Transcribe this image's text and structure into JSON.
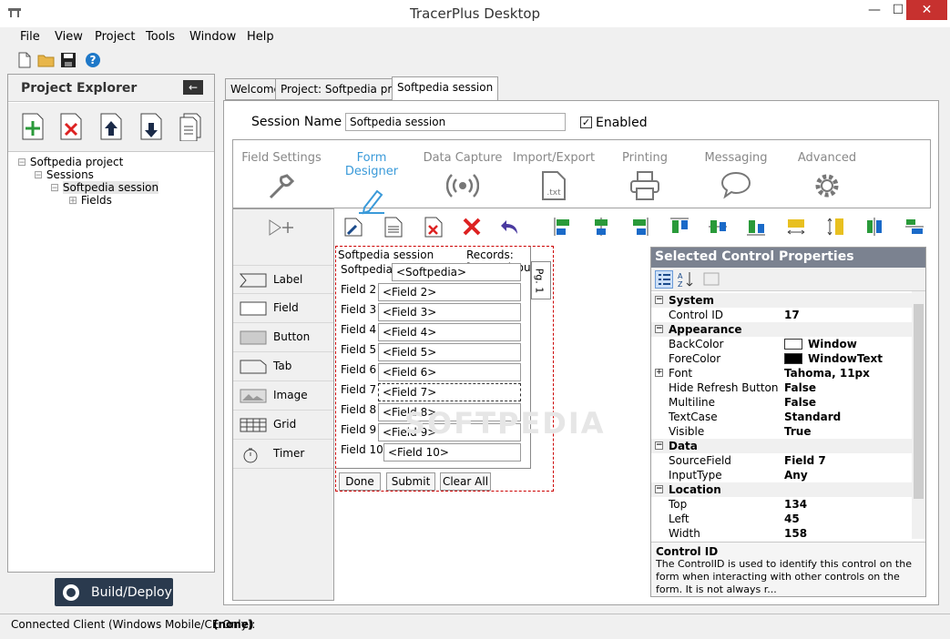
{
  "window": {
    "title": "TracerPlus Desktop",
    "min": "—",
    "max": "☐",
    "close": "✕"
  },
  "menu": [
    "File",
    "View",
    "Project",
    "Tools",
    "Window",
    "Help"
  ],
  "project_explorer": {
    "title": "Project Explorer",
    "tree": [
      "Softpedia project",
      "Sessions",
      "Softpedia session",
      "Fields"
    ]
  },
  "build_button": "Build/Deploy",
  "tabs": [
    "Welcome",
    "Project: Softpedia project",
    "Softpedia session"
  ],
  "session": {
    "label": "Session Name",
    "value": "Softpedia session",
    "enabled_label": "Enabled",
    "enabled": "✓"
  },
  "nav_items": [
    "Field Settings",
    "Form Designer",
    "Data Capture",
    "Import/Export",
    "Printing",
    "Messaging",
    "Advanced"
  ],
  "import_txt": ".txt",
  "palette": [
    "Label",
    "Field",
    "Button",
    "Tab",
    "Image",
    "Grid",
    "Timer"
  ],
  "form": {
    "header": "Softpedia session",
    "records": "Records:   [*recordcount*]",
    "rows": [
      {
        "label": "Softpedia",
        "value": "<Softpedia>"
      },
      {
        "label": "Field 2",
        "value": "<Field 2>"
      },
      {
        "label": "Field 3",
        "value": "<Field 3>"
      },
      {
        "label": "Field 4",
        "value": "<Field 4>"
      },
      {
        "label": "Field 5",
        "value": "<Field 5>"
      },
      {
        "label": "Field 6",
        "value": "<Field 6>"
      },
      {
        "label": "Field 7",
        "value": "<Field 7>"
      },
      {
        "label": "Field 8",
        "value": "<Field 8>"
      },
      {
        "label": "Field 9",
        "value": "<Field 9>"
      },
      {
        "label": "Field 10",
        "value": "<Field 10>"
      }
    ],
    "page_tab": "Pg. 1",
    "buttons": [
      "Done",
      "Submit",
      "Clear All"
    ],
    "watermark": "SOFTPEDIA"
  },
  "properties": {
    "title": "Selected Control Properties",
    "rows": [
      {
        "k": "System",
        "cat": true,
        "exp": "−"
      },
      {
        "k": "Control ID",
        "v": "17"
      },
      {
        "k": "Appearance",
        "cat": true,
        "exp": "−"
      },
      {
        "k": "BackColor",
        "v": "Window",
        "swatch": "#ffffff"
      },
      {
        "k": "ForeColor",
        "v": "WindowText",
        "swatch": "#000000"
      },
      {
        "k": "Font",
        "v": "Tahoma, 11px",
        "exp": "+"
      },
      {
        "k": "Hide Refresh Button",
        "v": "False"
      },
      {
        "k": "Multiline",
        "v": "False"
      },
      {
        "k": "TextCase",
        "v": "Standard"
      },
      {
        "k": "Visible",
        "v": "True"
      },
      {
        "k": "Data",
        "cat": true,
        "exp": "−"
      },
      {
        "k": "SourceField",
        "v": "Field 7"
      },
      {
        "k": "InputType",
        "v": "Any"
      },
      {
        "k": "Location",
        "cat": true,
        "exp": "−"
      },
      {
        "k": "Top",
        "v": "134"
      },
      {
        "k": "Left",
        "v": "45"
      },
      {
        "k": "Width",
        "v": "158"
      }
    ],
    "desc_title": "Control ID",
    "desc_text": "The ControlID is used to identify this control on the form when interacting with other controls on the form.  It is not always r..."
  },
  "status": {
    "label": "Connected Client (Windows Mobile/CE Only):",
    "value": "(none)"
  }
}
